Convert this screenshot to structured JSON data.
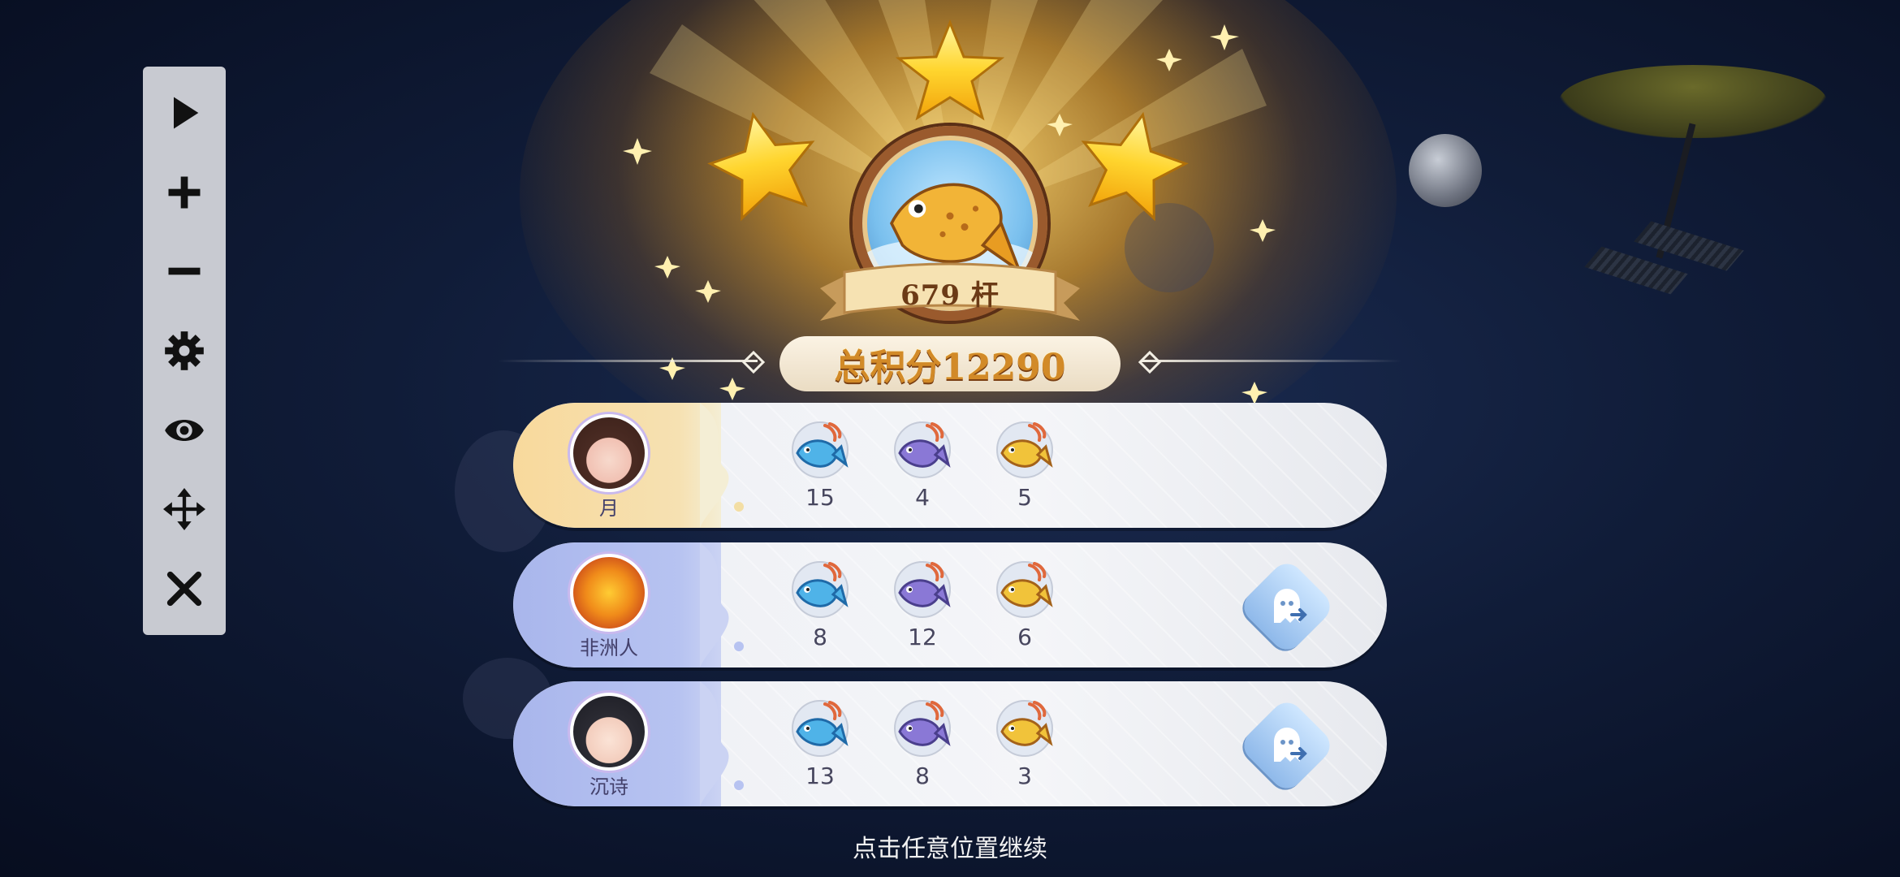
{
  "toolbar": {
    "items": [
      {
        "name": "play",
        "icon": "play-icon"
      },
      {
        "name": "zoom-in",
        "icon": "plus-icon"
      },
      {
        "name": "zoom-out",
        "icon": "minus-icon"
      },
      {
        "name": "settings",
        "icon": "gear-icon"
      },
      {
        "name": "view",
        "icon": "eye-icon"
      },
      {
        "name": "move",
        "icon": "move-icon"
      },
      {
        "name": "close",
        "icon": "close-icon"
      }
    ]
  },
  "result": {
    "catch_count": "679 杆",
    "total_score": "总积分12290",
    "stars": 3
  },
  "players": [
    {
      "name": "月",
      "theme": "gold",
      "counts": [
        "15",
        "4",
        "5"
      ],
      "has_action": false
    },
    {
      "name": "非洲人",
      "theme": "blue",
      "counts": [
        "8",
        "12",
        "6"
      ],
      "has_action": true
    },
    {
      "name": "沉诗",
      "theme": "blue",
      "counts": [
        "13",
        "8",
        "3"
      ],
      "has_action": true
    }
  ],
  "fish_icons": [
    "blue-fish-icon",
    "purple-fish-icon",
    "golden-fish-icon"
  ],
  "footer": {
    "hint": "点击任意位置继续"
  },
  "colors": {
    "score_text": "#d28a28",
    "toolbar_bg": "#c8cad1",
    "gold_row": "#f8d99c",
    "blue_row": "#a9b6ec"
  }
}
